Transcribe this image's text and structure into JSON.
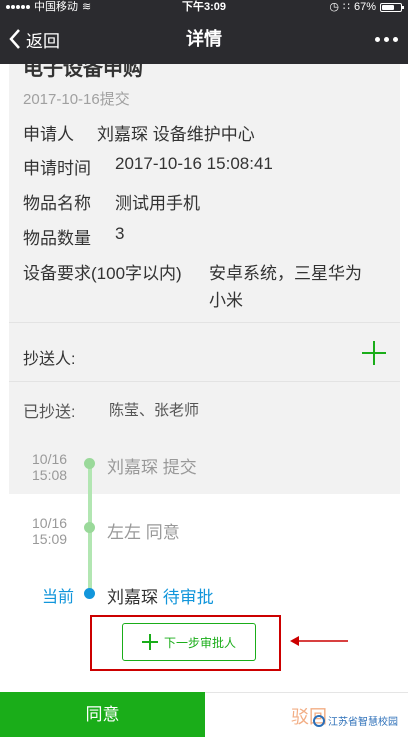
{
  "status_bar": {
    "carrier": "中国移动",
    "time": "下午3:09",
    "battery": "67%",
    "battery_level": 0.67
  },
  "nav": {
    "back_label": "返回",
    "title": "详情"
  },
  "detail": {
    "cut_title": "电子设备申购",
    "submit_date": "2017-10-16提交",
    "applicant_label": "申请人",
    "applicant_value": "刘嘉琛 设备维护中心",
    "time_label": "申请时间",
    "time_value": "2017-10-16 15:08:41",
    "item_label": "物品名称",
    "item_value": "测试用手机",
    "qty_label": "物品数量",
    "qty_value": "3",
    "req_label": "设备要求(100字以内)",
    "req_line1": "安卓系统，三星华为",
    "req_line2": "小米",
    "cc_label": "抄送人:",
    "sent_label": "已抄送:",
    "sent_value": "陈莹、张老师"
  },
  "timeline": [
    {
      "date": "10/16",
      "time": "15:08",
      "text": "刘嘉琛 提交"
    },
    {
      "date": "10/16",
      "time": "15:09",
      "text": "左左 同意"
    },
    {
      "now_label": "当前",
      "person": "刘嘉琛",
      "status": "待审批"
    }
  ],
  "next_approver_label": "下一步审批人",
  "bottom": {
    "agree_label": "同意",
    "reject_label": "驳回"
  },
  "watermark": "江苏省智慧校园"
}
